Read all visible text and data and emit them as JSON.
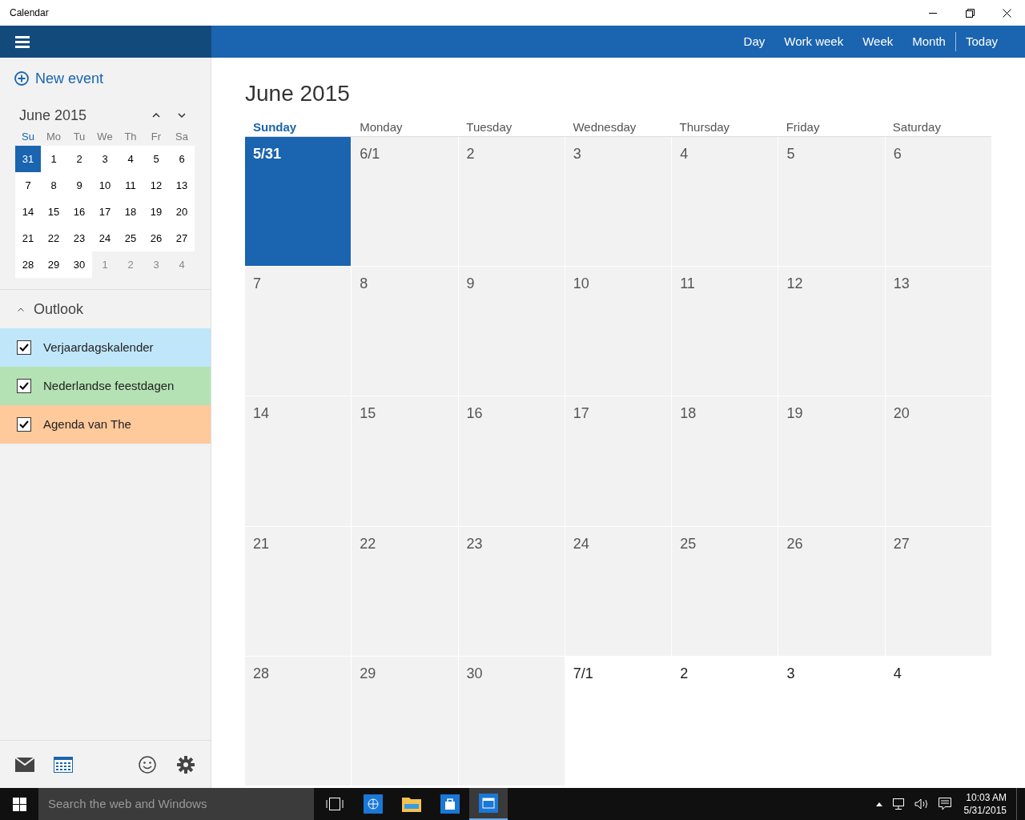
{
  "window": {
    "title": "Calendar"
  },
  "views": [
    {
      "label": "Day",
      "kind": "view"
    },
    {
      "label": "Work week",
      "kind": "view"
    },
    {
      "label": "Week",
      "kind": "view"
    },
    {
      "label": "Month",
      "kind": "view"
    },
    {
      "label": "Today",
      "kind": "action"
    }
  ],
  "sidebar": {
    "new_event": "New event",
    "mini_calendar": {
      "title": "June 2015",
      "weekdays": [
        {
          "label": "Su",
          "selected": true
        },
        {
          "label": "Mo",
          "selected": false
        },
        {
          "label": "Tu",
          "selected": false
        },
        {
          "label": "We",
          "selected": false
        },
        {
          "label": "Th",
          "selected": false
        },
        {
          "label": "Fr",
          "selected": false
        },
        {
          "label": "Sa",
          "selected": false
        }
      ],
      "days": [
        {
          "label": "31",
          "selected": true
        },
        {
          "label": "1",
          "in_month": true,
          "selected": false
        },
        {
          "label": "2",
          "in_month": true,
          "selected": false
        },
        {
          "label": "3",
          "in_month": true,
          "selected": false
        },
        {
          "label": "4",
          "in_month": true,
          "selected": false
        },
        {
          "label": "5",
          "in_month": true,
          "selected": false
        },
        {
          "label": "6",
          "in_month": true,
          "selected": false
        },
        {
          "label": "7",
          "in_month": true,
          "selected": false
        },
        {
          "label": "8",
          "in_month": true,
          "selected": false
        },
        {
          "label": "9",
          "in_month": true,
          "selected": false
        },
        {
          "label": "10",
          "in_month": true,
          "selected": false
        },
        {
          "label": "11",
          "in_month": true,
          "selected": false
        },
        {
          "label": "12",
          "in_month": true,
          "selected": false
        },
        {
          "label": "13",
          "in_month": true,
          "selected": false
        },
        {
          "label": "14",
          "in_month": true,
          "selected": false
        },
        {
          "label": "15",
          "in_month": true,
          "selected": false
        },
        {
          "label": "16",
          "in_month": true,
          "selected": false
        },
        {
          "label": "17",
          "in_month": true,
          "selected": false
        },
        {
          "label": "18",
          "in_month": true,
          "selected": false
        },
        {
          "label": "19",
          "in_month": true,
          "selected": false
        },
        {
          "label": "20",
          "in_month": true,
          "selected": false
        },
        {
          "label": "21",
          "in_month": true,
          "selected": false
        },
        {
          "label": "22",
          "in_month": true,
          "selected": false
        },
        {
          "label": "23",
          "in_month": true,
          "selected": false
        },
        {
          "label": "24",
          "in_month": true,
          "selected": false
        },
        {
          "label": "25",
          "in_month": true,
          "selected": false
        },
        {
          "label": "26",
          "in_month": true,
          "selected": false
        },
        {
          "label": "27",
          "in_month": true,
          "selected": false
        },
        {
          "label": "28",
          "in_month": true,
          "selected": false
        },
        {
          "label": "29",
          "in_month": true,
          "selected": false
        },
        {
          "label": "30",
          "in_month": true,
          "selected": false
        },
        {
          "label": "1",
          "in_month": false,
          "selected": false
        },
        {
          "label": "2",
          "in_month": false,
          "selected": false
        },
        {
          "label": "3",
          "in_month": false,
          "selected": false
        },
        {
          "label": "4",
          "in_month": false,
          "selected": false
        }
      ]
    },
    "account": {
      "label": "Outlook",
      "expanded": true
    },
    "calendars": [
      {
        "label": "Verjaardagskalender",
        "checked": true,
        "color": "#c0e6fa"
      },
      {
        "label": "Nederlandse feestdagen",
        "checked": true,
        "color": "#b4e2b4"
      },
      {
        "label": "Agenda van The",
        "checked": true,
        "color": "#fec99b"
      }
    ]
  },
  "month_view": {
    "title": "June 2015",
    "weekdays": [
      {
        "label": "Sunday",
        "selected": true
      },
      {
        "label": "Monday",
        "selected": false
      },
      {
        "label": "Tuesday",
        "selected": false
      },
      {
        "label": "Wednesday",
        "selected": false
      },
      {
        "label": "Thursday",
        "selected": false
      },
      {
        "label": "Friday",
        "selected": false
      },
      {
        "label": "Saturday",
        "selected": false
      }
    ],
    "days": [
      {
        "label": "5/31",
        "selected": true
      },
      {
        "label": "6/1",
        "in_month": true,
        "selected": false
      },
      {
        "label": "2",
        "in_month": true,
        "selected": false
      },
      {
        "label": "3",
        "in_month": true,
        "selected": false
      },
      {
        "label": "4",
        "in_month": true,
        "selected": false
      },
      {
        "label": "5",
        "in_month": true,
        "selected": false
      },
      {
        "label": "6",
        "in_month": true,
        "selected": false
      },
      {
        "label": "7",
        "in_month": true,
        "selected": false
      },
      {
        "label": "8",
        "in_month": true,
        "selected": false
      },
      {
        "label": "9",
        "in_month": true,
        "selected": false
      },
      {
        "label": "10",
        "in_month": true,
        "selected": false
      },
      {
        "label": "11",
        "in_month": true,
        "selected": false
      },
      {
        "label": "12",
        "in_month": true,
        "selected": false
      },
      {
        "label": "13",
        "in_month": true,
        "selected": false
      },
      {
        "label": "14",
        "in_month": true,
        "selected": false
      },
      {
        "label": "15",
        "in_month": true,
        "selected": false
      },
      {
        "label": "16",
        "in_month": true,
        "selected": false
      },
      {
        "label": "17",
        "in_month": true,
        "selected": false
      },
      {
        "label": "18",
        "in_month": true,
        "selected": false
      },
      {
        "label": "19",
        "in_month": true,
        "selected": false
      },
      {
        "label": "20",
        "in_month": true,
        "selected": false
      },
      {
        "label": "21",
        "in_month": true,
        "selected": false
      },
      {
        "label": "22",
        "in_month": true,
        "selected": false
      },
      {
        "label": "23",
        "in_month": true,
        "selected": false
      },
      {
        "label": "24",
        "in_month": true,
        "selected": false
      },
      {
        "label": "25",
        "in_month": true,
        "selected": false
      },
      {
        "label": "26",
        "in_month": true,
        "selected": false
      },
      {
        "label": "27",
        "in_month": true,
        "selected": false
      },
      {
        "label": "28",
        "in_month": true,
        "selected": false
      },
      {
        "label": "29",
        "in_month": true,
        "selected": false
      },
      {
        "label": "30",
        "in_month": true,
        "selected": false
      },
      {
        "label": "7/1",
        "in_month": false,
        "selected": false
      },
      {
        "label": "2",
        "in_month": false,
        "selected": false
      },
      {
        "label": "3",
        "in_month": false,
        "selected": false
      },
      {
        "label": "4",
        "in_month": false,
        "selected": false
      }
    ]
  },
  "taskbar": {
    "search": {
      "placeholder": "Search the web and Windows"
    },
    "apps": [
      {
        "kind": "taskview",
        "active": false
      },
      {
        "kind": "browser",
        "active": false
      },
      {
        "kind": "folder",
        "active": false
      },
      {
        "kind": "store",
        "active": false
      },
      {
        "kind": "calendar",
        "active": true
      }
    ],
    "time": "10:03 AM",
    "date": "5/31/2015"
  }
}
